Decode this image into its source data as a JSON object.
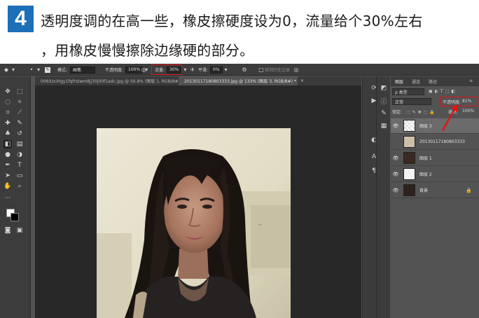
{
  "banner": {
    "step_number": "4",
    "line1": "透明度调的在高一些，橡皮擦硬度设为0，流量给个30%左右",
    "line2": "，用橡皮慢慢擦除边缘硬的部分。",
    "accent_color": "#1d6fb8"
  },
  "options_bar": {
    "mode_label": "模式:",
    "mode_value": "画笔",
    "opacity_label": "不透明度:",
    "opacity_value": "100%",
    "flow_label": "流量:",
    "flow_value": "30%",
    "smoothing_label": "平滑:",
    "smoothing_value": "0%",
    "erase_history_label": "抹到历史记录",
    "highlight_color": "#e01515"
  },
  "tabs": [
    {
      "label": "006XzciHgy1fqfrstwm8jj30j00f1adc.jpg @ 56.8% (图层 1, RGB/8#) *",
      "active": false
    },
    {
      "label": "20130117180803333.jpg @ 133% (图层 3, RGB/8#) *",
      "active": true
    }
  ],
  "layers_panel": {
    "tabs": [
      "图层",
      "通道",
      "路径"
    ],
    "filter_label": "ρ 类型",
    "blend_mode": "正常",
    "opacity_label": "不透明度:",
    "opacity_value": "81%",
    "lock_label": "锁定:",
    "fill_label": "填充:",
    "fill_value": "100%",
    "layers": [
      {
        "name": "图层 3",
        "visible": true,
        "selected": true
      },
      {
        "name": "20130117180803333",
        "visible": false,
        "selected": false
      },
      {
        "name": "图层 1",
        "visible": true,
        "selected": false
      },
      {
        "name": "图层 2",
        "visible": true,
        "selected": false
      },
      {
        "name": "背景",
        "visible": true,
        "selected": false,
        "locked": true
      }
    ]
  },
  "icons": [
    "move-icon",
    "marquee-icon",
    "lasso-icon",
    "quick-select-icon",
    "crop-icon",
    "eyedropper-icon",
    "healing-icon",
    "brush-icon",
    "stamp-icon",
    "history-brush-icon",
    "eraser-icon",
    "gradient-icon",
    "blur-icon",
    "dodge-icon",
    "pen-icon",
    "type-icon",
    "path-select-icon",
    "shape-icon",
    "hand-icon",
    "zoom-icon",
    "quick-mask-icon",
    "screen-mode-icon"
  ]
}
